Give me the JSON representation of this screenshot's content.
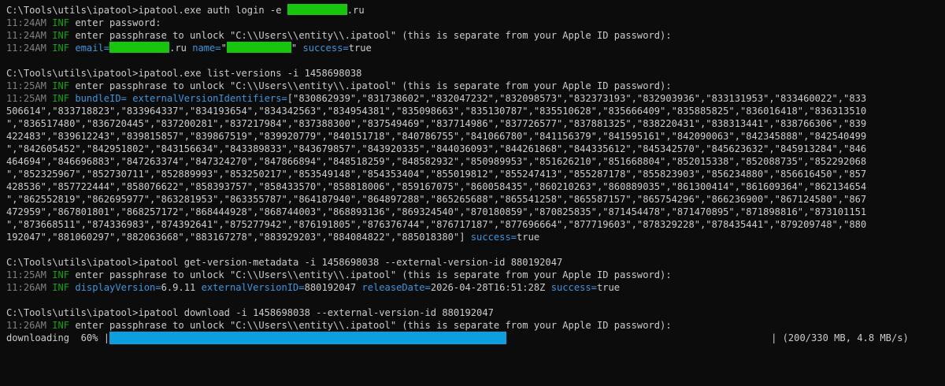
{
  "cmd1": {
    "prompt": "C:\\Tools\\utils\\ipatool>",
    "command": "ipatool.exe auth login -e ",
    "suffix": ".ru",
    "lines": [
      {
        "ts": "11:24AM",
        "lvl": "INF",
        "msg": "enter password:"
      },
      {
        "ts": "11:24AM",
        "lvl": "INF",
        "msg": "enter passphrase to unlock \"C:\\\\Users\\\\entity\\\\.ipatool\" (this is separate from your Apple ID password):"
      }
    ],
    "result": {
      "ts": "11:24AM",
      "lvl": "INF",
      "email_key": "email=",
      "email_suffix": ".ru ",
      "name_key": "name=",
      "name_open": "\"",
      "name_close": "\" ",
      "success_key": "success=",
      "success_val": "true"
    }
  },
  "cmd2": {
    "prompt": "C:\\Tools\\utils\\ipatool>",
    "command": "ipatool.exe list-versions -i 1458698038",
    "line1": {
      "ts": "11:25AM",
      "lvl": "INF",
      "msg": "enter passphrase to unlock \"C:\\\\Users\\\\entity\\\\.ipatool\" (this is separate from your Apple ID password):"
    },
    "line2": {
      "ts": "11:25AM",
      "lvl": "INF",
      "bundle_key": "bundleID=",
      "ids_key": "externalVersionIdentifiers=",
      "ids_first": "[\"830862939\",\"831738602\",\"832047232\",\"832098573\",\"832373193\",\"832903936\",\"833131953\",\"833460022\",\"833"
    },
    "wrapped": [
      "506614\",\"833718823\",\"833964337\",\"834193654\",\"834342563\",\"834954381\",\"835098663\",\"835130787\",\"835510628\",\"835666409\",\"835885825\",\"836016418\",\"836313510",
      "\",\"836517480\",\"836720445\",\"837200281\",\"837217984\",\"837388300\",\"837549469\",\"837714986\",\"837726577\",\"837881325\",\"838220431\",\"838313441\",\"838766306\",\"839",
      "422483\",\"839612243\",\"839815857\",\"839867519\",\"839920779\",\"840151718\",\"840786755\",\"841066780\",\"841156379\",\"841595161\",\"842090063\",\"842345888\",\"842540499",
      "\",\"842605452\",\"842951802\",\"843156634\",\"843389833\",\"843679857\",\"843920335\",\"844036093\",\"844261868\",\"844335612\",\"845342570\",\"845623632\",\"845913284\",\"846",
      "464694\",\"846696883\",\"847263374\",\"847324270\",\"847866894\",\"848518259\",\"848582932\",\"850989953\",\"851626210\",\"851668804\",\"852015338\",\"852088735\",\"852292068",
      "\",\"852325967\",\"852730711\",\"852889993\",\"853250217\",\"853549148\",\"854353404\",\"855019812\",\"855247413\",\"855287178\",\"855823903\",\"856234880\",\"856616450\",\"857",
      "428536\",\"857722444\",\"858076622\",\"858393757\",\"858433570\",\"858818006\",\"859167075\",\"860058435\",\"860210263\",\"860889035\",\"861300414\",\"861609364\",\"862134654",
      "\",\"862552819\",\"862695977\",\"863281953\",\"863355787\",\"864187940\",\"864897288\",\"865265688\",\"865541258\",\"865587157\",\"865754296\",\"866236900\",\"867124580\",\"867",
      "472959\",\"867801801\",\"868257172\",\"868444928\",\"868744003\",\"868893136\",\"869324540\",\"870180859\",\"870825835\",\"871454478\",\"871470895\",\"871898816\",\"873101151",
      "\",\"873668511\",\"874336983\",\"874392641\",\"875277942\",\"876191805\",\"876376744\",\"876717187\",\"877696664\",\"877719603\",\"878329228\",\"878435441\",\"879209748\",\"880"
    ],
    "last_wrapped": "192047\",\"881060297\",\"882063668\",\"883167278\",\"883929203\",\"884084822\",\"885018380\"] ",
    "success_key": "success=",
    "success_val": "true"
  },
  "cmd3": {
    "prompt": "C:\\Tools\\utils\\ipatool>",
    "command": "ipatool get-version-metadata -i 1458698038 --external-version-id 880192047",
    "line1": {
      "ts": "11:25AM",
      "lvl": "INF",
      "msg": "enter passphrase to unlock \"C:\\\\Users\\\\entity\\\\.ipatool\" (this is separate from your Apple ID password):"
    },
    "line2": {
      "ts": "11:26AM",
      "lvl": "INF",
      "display_key": "displayVersion=",
      "display_val": "6.9.11 ",
      "ext_key": "externalVersionID=",
      "ext_val": "880192047 ",
      "release_key": "releaseDate=",
      "release_val": "2026-04-28T16:51:28Z ",
      "success_key": "success=",
      "success_val": "true"
    }
  },
  "cmd4": {
    "prompt": "C:\\Tools\\utils\\ipatool>",
    "command": "ipatool download -i 1458698038 --external-version-id 880192047",
    "line1": {
      "ts": "11:26AM",
      "lvl": "INF",
      "msg": "enter passphrase to unlock \"C:\\\\Users\\\\entity\\\\.ipatool\" (this is separate from your Apple ID password):"
    },
    "progress": {
      "label": "downloading  60% |",
      "fraction": 0.6,
      "stats": "| (200/330 MB, 4.8 MB/s)"
    }
  },
  "colors": {
    "background": "#0c0c0c",
    "text": "#cccccc",
    "timestamp": "#808080",
    "info": "#13a10e",
    "key": "#3a96dd",
    "redaction": "#16c60c",
    "progress": "#0c9fe0"
  }
}
